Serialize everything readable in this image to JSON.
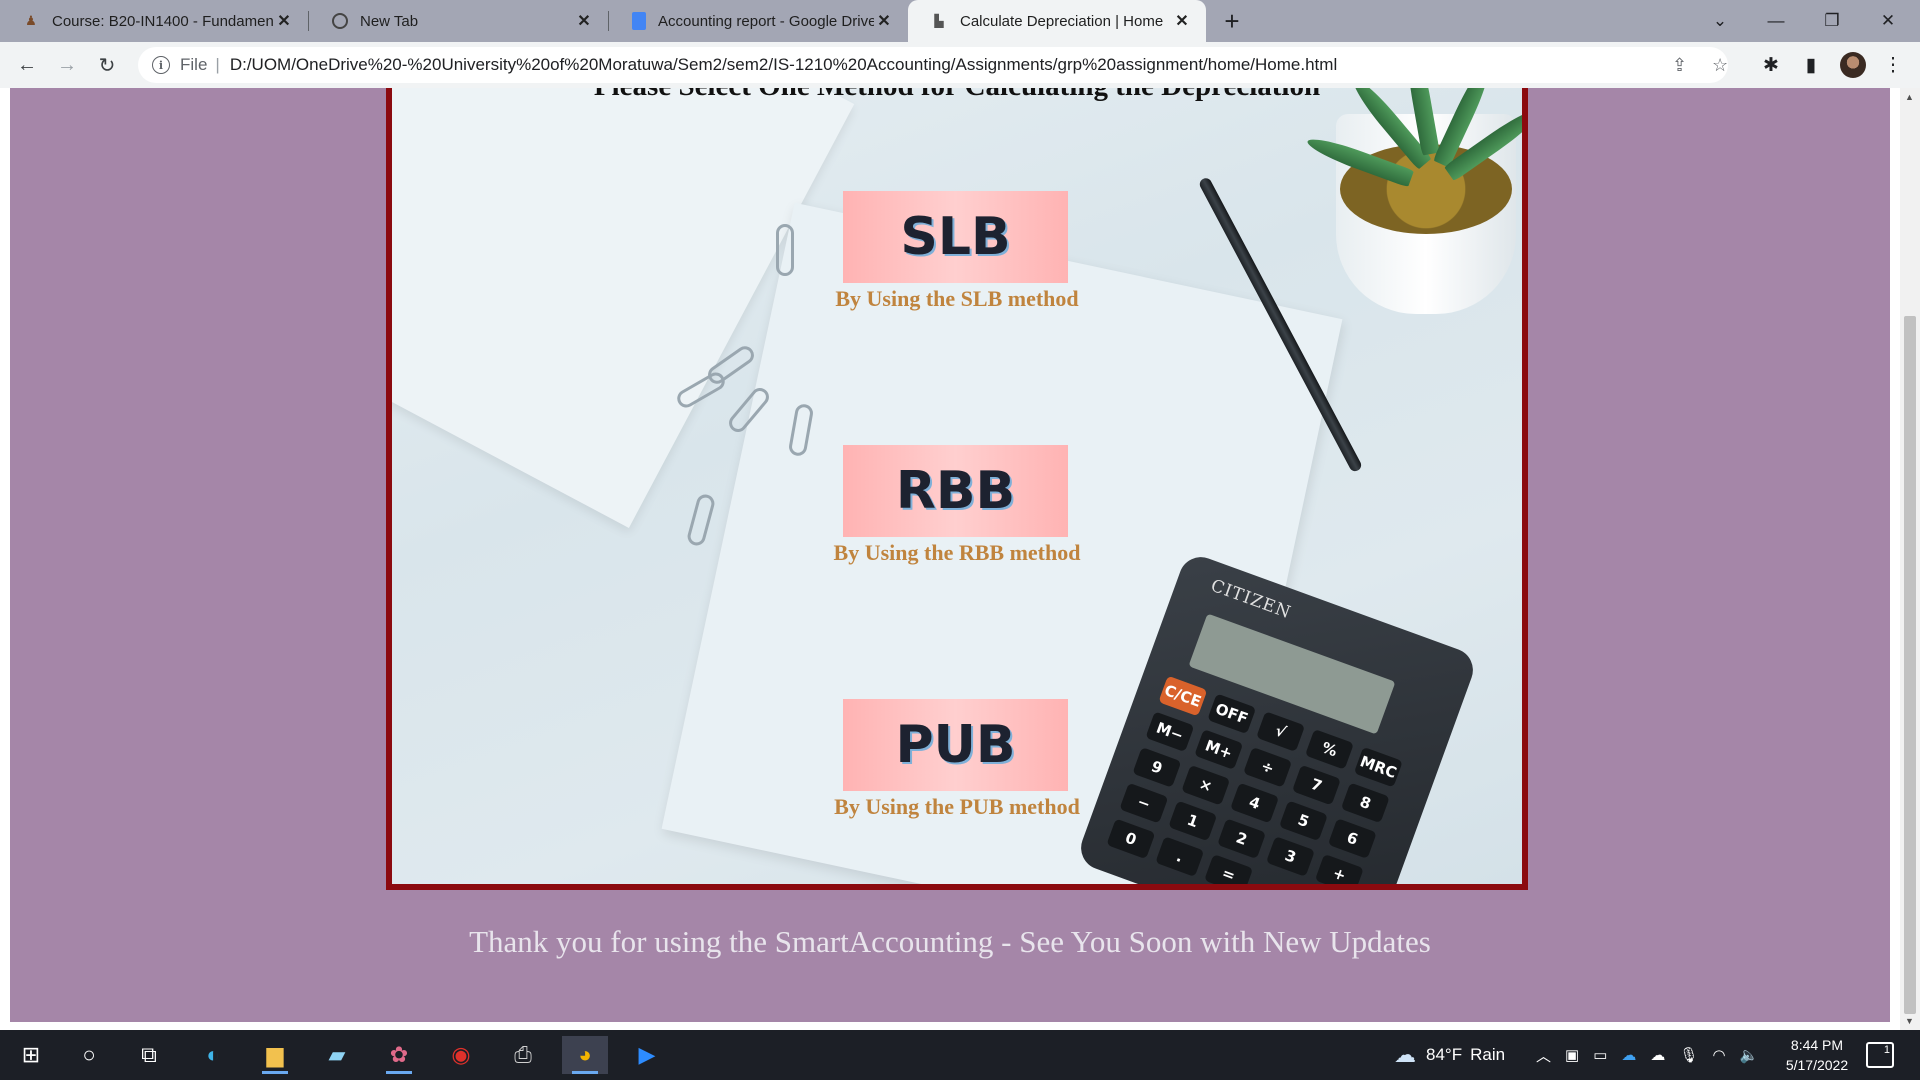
{
  "browser": {
    "tabs": [
      {
        "title": "Course: B20-IN1400 - Fundamen",
        "favicon": "course-icon",
        "active": false
      },
      {
        "title": "New Tab",
        "favicon": "chrome-icon",
        "active": false
      },
      {
        "title": "Accounting report - Google Drive",
        "favicon": "docs-icon",
        "active": false
      },
      {
        "title": "Calculate Depreciation | Home",
        "favicon": "page-icon",
        "active": true
      }
    ],
    "address": {
      "scheme": "File",
      "url": "D:/UOM/OneDrive%20-%20University%20of%20Moratuwa/Sem2/sem2/IS-1210%20Accounting/Assignments/grp%20assignment/home/Home.html"
    }
  },
  "page": {
    "heading": "Please Select One Method for Calculating the Depreciation",
    "methods": [
      {
        "label": "SLB",
        "description": "By Using the SLB method"
      },
      {
        "label": "RBB",
        "description": "By Using the RBB method"
      },
      {
        "label": "PUB",
        "description": "By Using the PUB method"
      }
    ],
    "footer": "Thank you for using the SmartAccounting - See You Soon with New Updates",
    "calculator": {
      "brand": "CITIZEN",
      "keys": [
        "C/CE",
        "OFF",
        "√",
        "%",
        "MRC",
        "M−",
        "M+",
        "÷",
        "7",
        "8",
        "9",
        "×",
        "4",
        "5",
        "6",
        "−",
        "1",
        "2",
        "3",
        "+",
        "0",
        ".",
        "="
      ]
    }
  },
  "taskbar": {
    "weather": {
      "temp": "84°F",
      "condition": "Rain"
    },
    "time": "8:44 PM",
    "date": "5/17/2022",
    "notifications": "1"
  },
  "colors": {
    "page_background": "#a586a8",
    "frame_border": "#8b0a0f",
    "button_fill": "#ffc0c0",
    "description_text": "#c0843e"
  }
}
